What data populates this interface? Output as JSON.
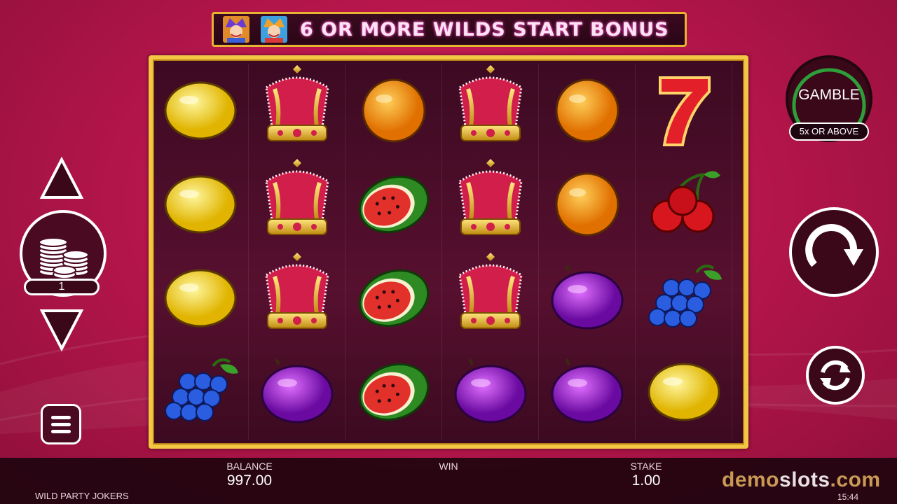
{
  "banner": {
    "text": "6 OR MORE WILDS START BONUS",
    "icons": [
      "jester-wild-icon",
      "jester-wild-icon"
    ]
  },
  "reels": [
    [
      "lemon",
      "lemon",
      "lemon",
      "grapes"
    ],
    [
      "crown",
      "crown",
      "crown",
      "plum"
    ],
    [
      "orange",
      "watermelon",
      "watermelon",
      "watermelon"
    ],
    [
      "crown",
      "crown",
      "crown",
      "plum"
    ],
    [
      "orange",
      "orange",
      "plum",
      "plum"
    ],
    [
      "seven",
      "cherries",
      "grapes",
      "lemon"
    ]
  ],
  "controls": {
    "stake_level": "1",
    "gamble_label": "GAMBLE",
    "gamble_sub": "5x OR ABOVE"
  },
  "bottom_bar": {
    "balance_label": "BALANCE",
    "balance_value": "997.00",
    "win_label": "WIN",
    "win_value": "",
    "stake_label": "STAKE",
    "stake_value": "1.00",
    "game_name": "WILD PARTY JOKERS",
    "clock": "15:44",
    "logo_demo": "demo",
    "logo_slots": "slots",
    "logo_com": ".com"
  },
  "colors": {
    "frame_gold": "#f2c744",
    "background": "#b8164c",
    "gamble_ring": "#2e9e3a",
    "banner_text_glow": "#ff5ad0"
  }
}
